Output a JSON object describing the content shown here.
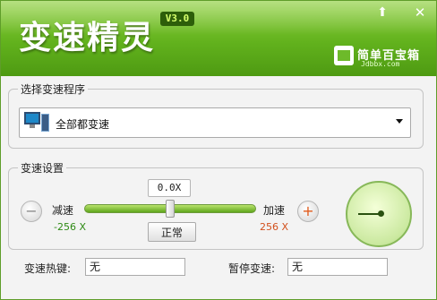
{
  "header": {
    "title": "变速精灵",
    "version": "V3.0",
    "logo_name": "简单百宝箱",
    "logo_url": "Jdbbx.com",
    "minimize_glyph": "⬆",
    "close_glyph": "✕"
  },
  "program_group": {
    "title": "选择变速程序",
    "selected": "全部都变速",
    "icon": "computer-icon"
  },
  "speed_group": {
    "title": "变速设置",
    "current_value": "0.0X",
    "decrease_label": "减速",
    "increase_label": "加速",
    "min_value": "-256 X",
    "max_value": "256 X",
    "normal_label": "正常",
    "minus_glyph": "−",
    "plus_glyph": "+",
    "slider_position": 0.5
  },
  "hotkeys": {
    "speed_label": "变速热键:",
    "speed_value": "无",
    "pause_label": "暂停变速:",
    "pause_value": "无"
  },
  "colors": {
    "header_green": "#62b21d",
    "accent_dark": "#2d5e0a",
    "min_color": "#2e8a14",
    "max_color": "#d2501c"
  }
}
